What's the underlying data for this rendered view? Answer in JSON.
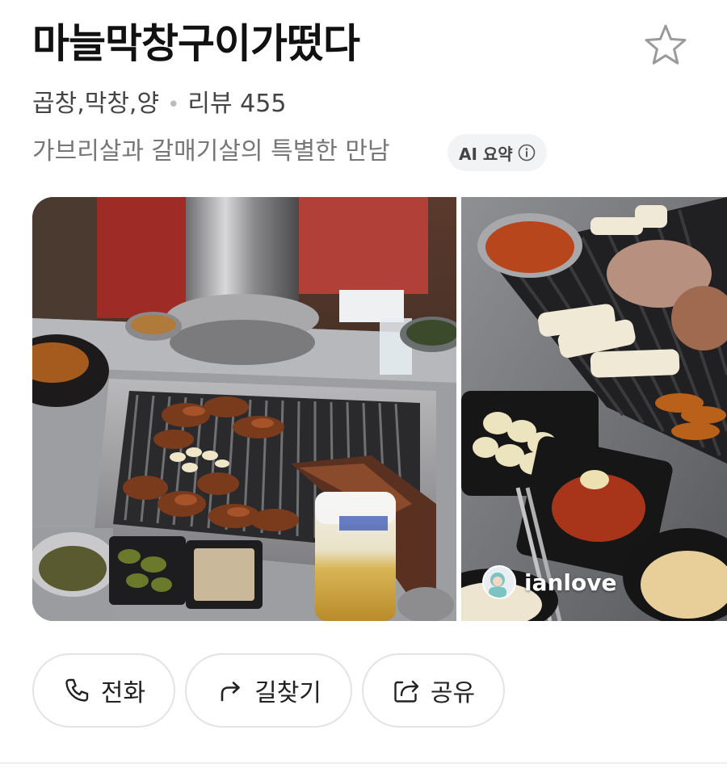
{
  "place": {
    "name": "마늘막창구이가떴다",
    "category": "곱창,막창,양",
    "review_label": "리뷰",
    "review_count": "455",
    "summary": "가브리살과 갈매기살의 특별한 만남",
    "ai_badge": "AI 요약"
  },
  "icons": {
    "favorite": "star-outline-icon",
    "info": "info-circle-icon",
    "call": "phone-icon",
    "route": "route-arrow-icon",
    "share": "share-icon"
  },
  "photos": {
    "main_subject": "grilled makchang on barbecue grill with side dishes",
    "side_subject": "grilled pork and side dishes",
    "watermark_user": "ianlove"
  },
  "actions": {
    "call_label": "전화",
    "route_label": "길찾기",
    "share_label": "공유"
  },
  "colors": {
    "title": "#111111",
    "meta": "#444444",
    "summary": "#777777",
    "badge_bg": "#f2f3f5",
    "button_border": "#e3e3e3"
  }
}
